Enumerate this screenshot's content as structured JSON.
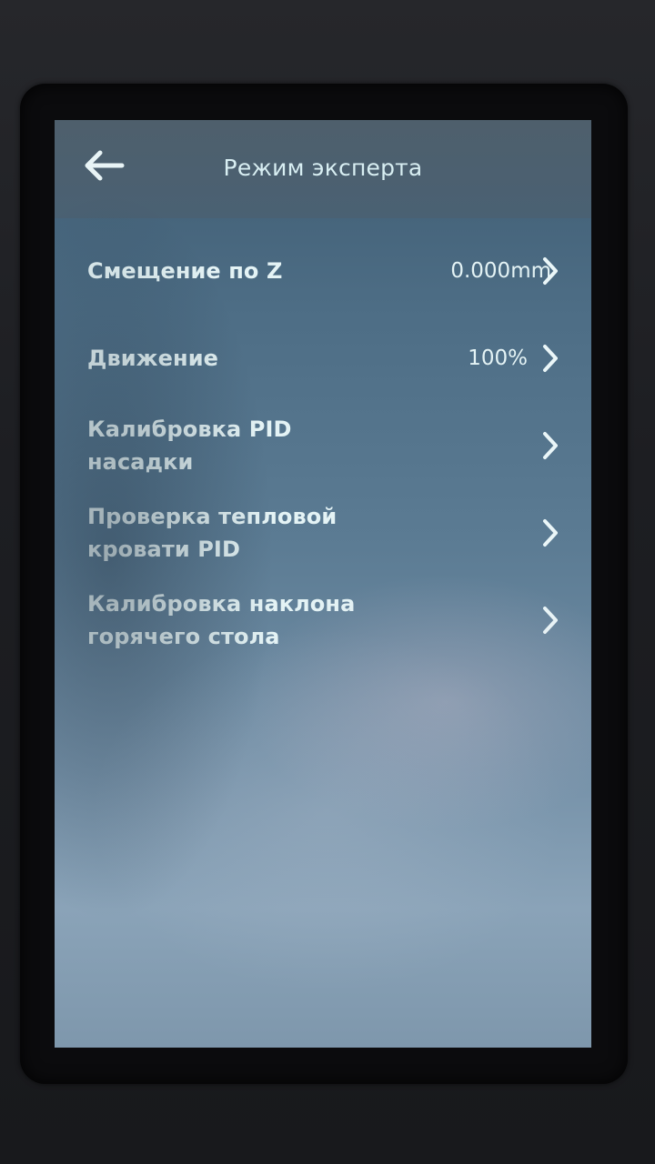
{
  "header": {
    "title": "Режим эксперта",
    "back_icon": "arrow-left-icon"
  },
  "menu": {
    "items": [
      {
        "label": "Смещение по Z",
        "value": "0.000mm",
        "icon": "chevron-right-icon"
      },
      {
        "label": "Движение",
        "value": "100%",
        "icon": "chevron-right-icon"
      },
      {
        "label": "Калибровка PID насадки",
        "value": "",
        "icon": "chevron-right-icon"
      },
      {
        "label": "Проверка тепловой кровати PID",
        "value": "",
        "icon": "chevron-right-icon"
      },
      {
        "label": "Калибровка наклона горячего стола",
        "value": "",
        "icon": "chevron-right-icon"
      }
    ]
  },
  "colors": {
    "text": "#e4f3f5",
    "header_background": "#4e5f6c",
    "screen_background": "#5b7b93"
  }
}
